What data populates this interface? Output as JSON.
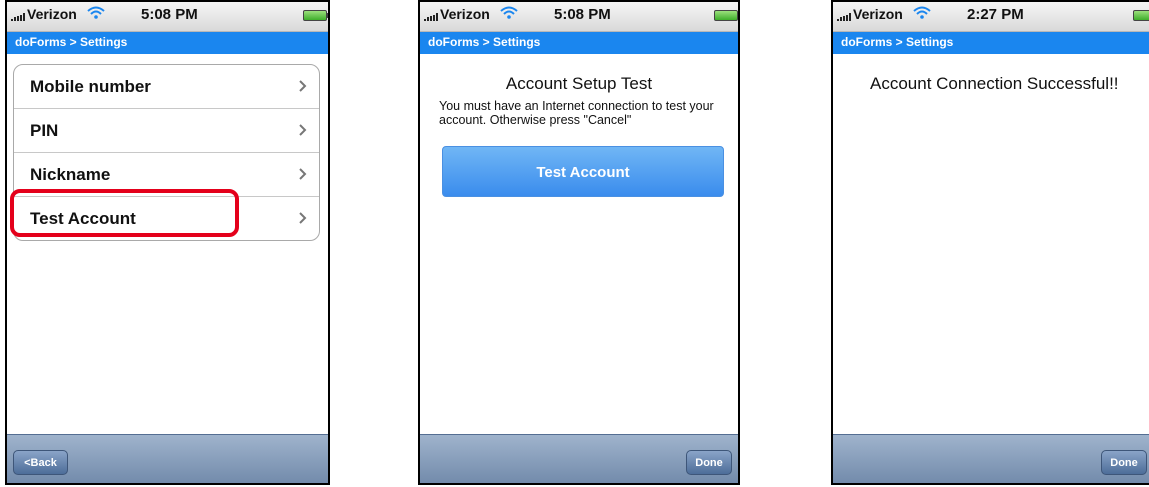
{
  "screens": [
    {
      "status": {
        "carrier": "Verizon",
        "time": "5:08 PM"
      },
      "nav": {
        "title": "doForms > Settings"
      },
      "list": [
        "Mobile number",
        "PIN",
        "Nickname",
        "Test Account"
      ],
      "toolbar": {
        "back_label": "<Back"
      }
    },
    {
      "status": {
        "carrier": "Verizon",
        "time": "5:08 PM"
      },
      "nav": {
        "title": "doForms > Settings"
      },
      "title": "Account Setup Test",
      "message": "You must have an Internet connection to test your account.  Otherwise press \"Cancel\"",
      "button": "Test Account",
      "toolbar": {
        "done_label": "Done"
      }
    },
    {
      "status": {
        "carrier": "Verizon",
        "time": "2:27 PM"
      },
      "nav": {
        "title": "doForms > Settings"
      },
      "message": "Account Connection Successful!!",
      "toolbar": {
        "done_label": "Done"
      }
    }
  ],
  "colors": {
    "nav_bar": "#1a86ef",
    "highlight": "#e4001b",
    "test_button": "#3a8ced"
  },
  "icons": [
    "signal-bars-icon",
    "wifi-icon",
    "battery-icon",
    "chevron-right-icon"
  ]
}
